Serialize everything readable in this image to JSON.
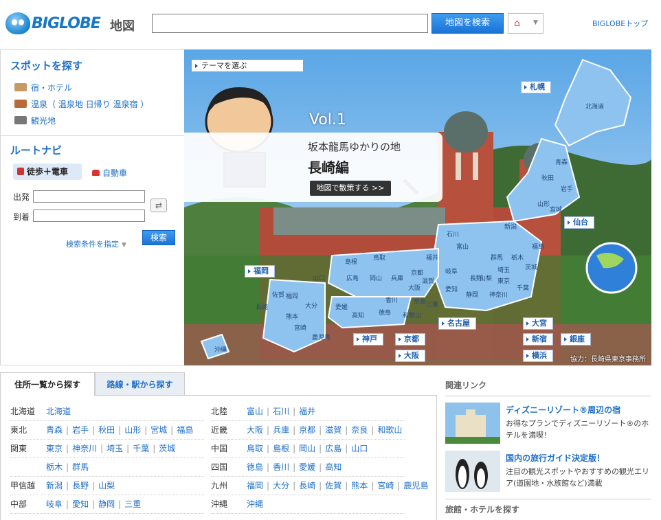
{
  "header": {
    "logo": "BIGLOBE",
    "logo_sub": "地図",
    "search_value": "",
    "search_button": "地図を検索",
    "home_icon": "home-icon",
    "top_link": "BIGLOBEトップ"
  },
  "spot": {
    "title": "スポットを探す",
    "items": [
      {
        "label": "宿・ホテル",
        "icon": "bed-icon"
      },
      {
        "label": "温泉（ 温泉地 日帰り 温泉宿 ）",
        "icon": "onsen-icon"
      },
      {
        "label": "観光地",
        "icon": "camera-icon"
      }
    ]
  },
  "route": {
    "title": "ルートナビ",
    "mode_train": "徒歩＋電車",
    "mode_car": "自動車",
    "from_label": "出発",
    "to_label": "到着",
    "from_value": "",
    "to_value": "",
    "swap_icon": "swap-icon",
    "conditions": "検索条件を指定",
    "search_button": "検索"
  },
  "banner": {
    "theme_select": "テーマを選ぶ",
    "vol": "Vol.1",
    "feature_title": "坂本龍馬ゆかりの地",
    "feature_subtitle": "長崎編",
    "walk_button": "地図で散策する >>",
    "credit": "協力：長崎県東京事務所",
    "city_links": [
      "札幌",
      "仙台",
      "福岡",
      "名古屋",
      "大宮",
      "神戸",
      "京都",
      "新宿",
      "銀座",
      "大阪",
      "横浜"
    ],
    "map_labels": [
      "北海道",
      "青森",
      "秋田",
      "岩手",
      "山形",
      "宮城",
      "新潟",
      "福島",
      "石川",
      "富山",
      "島根",
      "鳥取",
      "山口",
      "広島",
      "岡山",
      "兵庫",
      "京都",
      "福井",
      "岐阜",
      "長野",
      "群馬",
      "栃木",
      "茨城",
      "埼玉",
      "東京",
      "千葉",
      "山梨",
      "神奈川",
      "静岡",
      "愛知",
      "滋賀",
      "大阪",
      "奈良",
      "和歌山",
      "三重",
      "香川",
      "徳島",
      "愛媛",
      "高知",
      "福岡",
      "佐賀",
      "長崎",
      "大分",
      "熊本",
      "宮崎",
      "鹿児島",
      "沖縄"
    ]
  },
  "tabs": {
    "address": "住所一覧から探す",
    "rail": "路線・駅から探す"
  },
  "regions_left": [
    {
      "name": "北海道",
      "prefs": [
        "北海道"
      ]
    },
    {
      "name": "東北",
      "prefs": [
        "青森",
        "岩手",
        "秋田",
        "山形",
        "宮城",
        "福島"
      ]
    },
    {
      "name": "関東",
      "prefs": [
        "東京",
        "神奈川",
        "埼玉",
        "千葉",
        "茨城"
      ]
    },
    {
      "name": "",
      "prefs": [
        "栃木",
        "群馬"
      ]
    },
    {
      "name": "甲信越",
      "prefs": [
        "新潟",
        "長野",
        "山梨"
      ]
    },
    {
      "name": "中部",
      "prefs": [
        "岐阜",
        "愛知",
        "静岡",
        "三重"
      ]
    }
  ],
  "regions_right": [
    {
      "name": "北陸",
      "prefs": [
        "富山",
        "石川",
        "福井"
      ]
    },
    {
      "name": "近畿",
      "prefs": [
        "大阪",
        "兵庫",
        "京都",
        "滋賀",
        "奈良",
        "和歌山"
      ]
    },
    {
      "name": "中国",
      "prefs": [
        "鳥取",
        "島根",
        "岡山",
        "広島",
        "山口"
      ]
    },
    {
      "name": "四国",
      "prefs": [
        "徳島",
        "香川",
        "愛媛",
        "高知"
      ]
    },
    {
      "name": "九州",
      "prefs": [
        "福岡",
        "大分",
        "長崎",
        "佐賀",
        "熊本",
        "宮崎",
        "鹿児島"
      ]
    },
    {
      "name": "沖縄",
      "prefs": [
        "沖縄"
      ]
    }
  ],
  "related": {
    "title": "関連リンク",
    "items": [
      {
        "head": "ディズニーリゾート®周辺の宿",
        "desc": "お得なプランでディズニーリゾート®のホテルを満喫！"
      },
      {
        "head": "国内の旅行ガイド決定版！",
        "desc": "注目の観光スポットやおすすめの観光エリア(道園地・水族館など)満載"
      }
    ],
    "hotel_title": "旅館・ホテルを探す"
  },
  "colors": {
    "link": "#1e6ec8",
    "button": "#1b73d6",
    "map_pref": "#8ec3f0",
    "map_border": "#ffffff"
  }
}
